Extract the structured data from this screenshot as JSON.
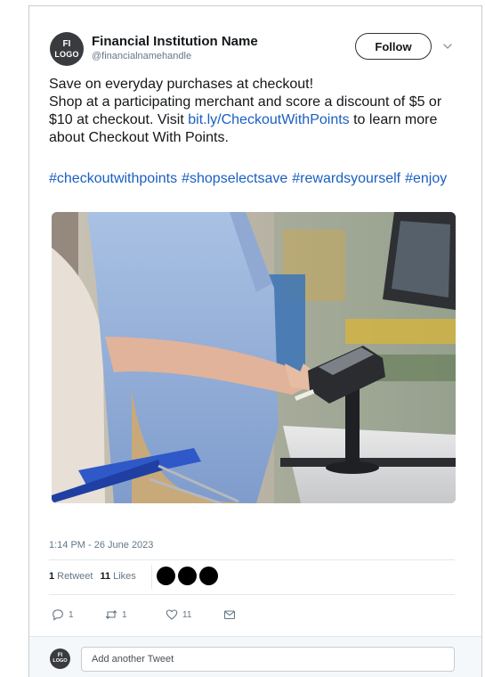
{
  "account": {
    "avatar_line1": "FI",
    "avatar_line2": "LOGO",
    "name": "Financial Institution Name",
    "handle": "@financialnamehandle"
  },
  "follow_label": "Follow",
  "tweet": {
    "line1": "Save on everyday purchases at checkout!",
    "line2": "Shop at a participating merchant and score a discount of $5 or",
    "line3_before_link": "$10 at checkout. Visit ",
    "link": "bit.ly/CheckoutWithPoints",
    "line3_after_link": " to learn more",
    "line4": "about Checkout With Points.",
    "hashtags": [
      "#checkoutwithpoints",
      "#shopselectsave",
      "#rewardsyourself",
      "#enjoy"
    ]
  },
  "timestamp": "1:14 PM - 26 June 2023",
  "stats": {
    "retweets_count": "1",
    "retweets_label": "Retweet",
    "likes_count": "11",
    "likes_label": "Likes"
  },
  "actions": {
    "reply_count": "1",
    "retweet_count": "1",
    "like_count": "11"
  },
  "icons": {
    "reply": "reply-icon",
    "retweet": "retweet-icon",
    "like": "heart-icon",
    "message": "envelope-icon",
    "menu": "chevron-down-icon"
  },
  "reply_bar": {
    "avatar_line1": "FI",
    "avatar_line2": "LOGO",
    "placeholder": "Add another Tweet"
  },
  "colors": {
    "link": "#1b5fc1",
    "meta_text": "#657786",
    "avatar_bg": "#3a3b3e"
  }
}
